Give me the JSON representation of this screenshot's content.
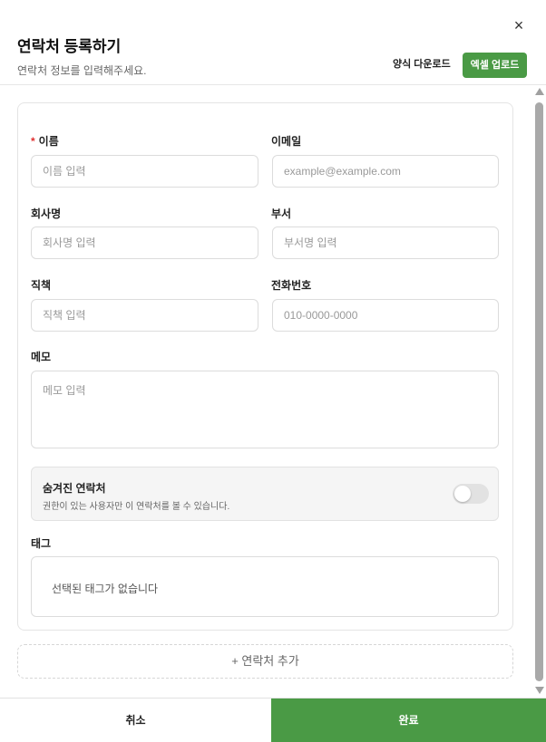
{
  "header": {
    "title": "연락처 등록하기",
    "subtitle": "연락처 정보를 입력해주세요.",
    "close_symbol": "×",
    "download_label": "양식 다운로드",
    "upload_label": "엑셀 업로드"
  },
  "form": {
    "required_mark": "*",
    "name": {
      "label": "이름",
      "placeholder": "이름 입력",
      "required": true
    },
    "email": {
      "label": "이메일",
      "placeholder": "example@example.com"
    },
    "company": {
      "label": "회사명",
      "placeholder": "회사명 입력"
    },
    "department": {
      "label": "부서",
      "placeholder": "부서명 입력"
    },
    "position": {
      "label": "직책",
      "placeholder": "직책 입력"
    },
    "phone": {
      "label": "전화번호",
      "placeholder": "010-0000-0000"
    },
    "memo": {
      "label": "메모",
      "placeholder": "메모 입력"
    },
    "hidden_contact": {
      "title": "숨겨진 연락처",
      "description": "권한이 있는 사용자만 이 연락처를 볼 수 있습니다.",
      "enabled": false
    },
    "tags": {
      "label": "태그",
      "empty_text": "선택된 태그가 없습니다"
    }
  },
  "add_contact_label": "+ 연락처 추가",
  "footer": {
    "cancel_label": "취소",
    "done_label": "완료"
  },
  "colors": {
    "accent": "#4a9a45",
    "required": "#e03030"
  }
}
